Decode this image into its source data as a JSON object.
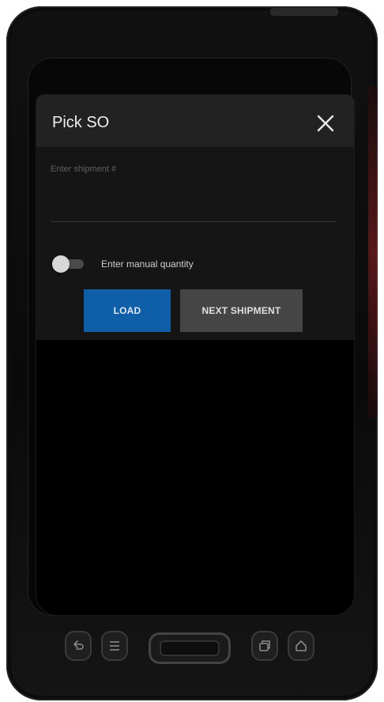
{
  "app": {
    "title": "Pick SO",
    "close_icon": "close-icon"
  },
  "form": {
    "shipment_field": {
      "label": "Enter shipment #",
      "value": ""
    },
    "manual_quantity": {
      "label": "Enter manual quantity",
      "enabled": false
    },
    "buttons": {
      "load_label": "LOAD",
      "next_shipment_label": "NEXT SHIPMENT"
    }
  },
  "colors": {
    "primary_button": "#0e5fa8",
    "secondary_button": "#454545",
    "header": "#222222",
    "panel": "#151515"
  },
  "hardware_keys": {
    "left": [
      "back-icon",
      "menu-icon"
    ],
    "center": "scan-trigger",
    "right": [
      "recent-apps-icon",
      "home-icon"
    ]
  }
}
